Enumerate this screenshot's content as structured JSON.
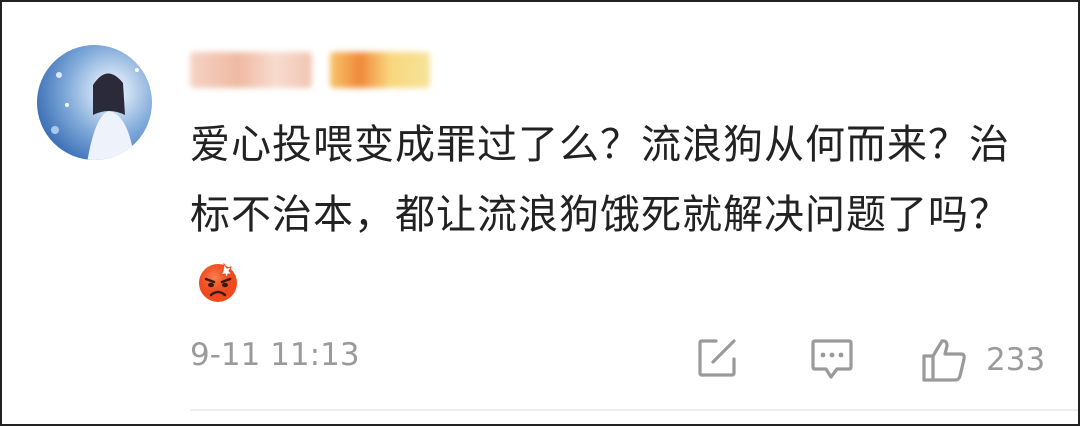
{
  "comment": {
    "text": "爱心投喂变成罪过了么？流浪狗从何而来？治标不治本，都让流浪狗饿死就解决问题了吗？",
    "timestamp": "9-11 11:13",
    "likes": "233"
  },
  "icons": {
    "avatar": "user-avatar",
    "emoji": "angry-face-emoji",
    "share": "share-icon",
    "reply": "reply-icon",
    "like": "thumbs-up-icon"
  },
  "colors": {
    "text": "#222222",
    "meta": "#9a9a9a",
    "icon": "#9a9a9a",
    "emoji": "#f04a1e"
  }
}
